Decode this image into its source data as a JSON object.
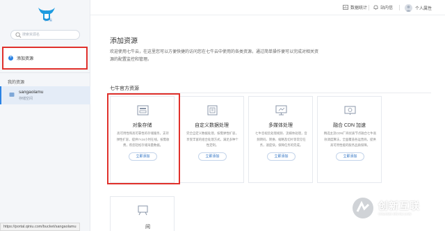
{
  "sidebar": {
    "logo_text": "七牛云",
    "search_placeholder": "搜索资源名",
    "add_resource": "添加资源",
    "my_resources": "我的资源",
    "resource": {
      "name": "sangaolamu",
      "type": "存储空间"
    }
  },
  "topbar": {
    "stats": "数据统计",
    "messages": "站内信",
    "user": "个人属性"
  },
  "main": {
    "title": "添加资源",
    "description": "欢迎使用七牛云，在这里您可以方便快捷的访问您在七牛云中使用的各类资源，通过简单操作便可以完成对相关资源的配置监控和管理。",
    "section": "七牛官方资源",
    "cards": [
      {
        "title": "对象存储",
        "desc": "高可用性和高可靠性的存储服务，支持弹性扩容，提供7×24小时在线，按需收费，帮您轻松存储海量数据。",
        "button": "立即添加"
      },
      {
        "title": "自定义数据处理",
        "desc": "完全自定义数据处理，按需弹性扩容，享受丰富的组合处理方式，满足多种个性定制。",
        "button": "立即添加"
      },
      {
        "title": "多媒体处理",
        "desc": "七牛音视云处理视频、流媒体处理，音频转码、转换、缩略及切片等常见任务，速度快，保障任务的完成。",
        "button": "立即添加"
      },
      {
        "title": "融合 CDN 加速",
        "desc": "精选主流CDN厂商优质节点融合七牛高效调度算法，全面覆盖各运营商，提供高可用性能的服务品质保障。",
        "button": "立即添加"
      }
    ],
    "card5_tail": "间"
  },
  "status_url": "https://portal.qiniu.com/bucket/sangaolamu",
  "watermark": {
    "cn": "创新互联",
    "en": "CHUANG XIN HU LIAN"
  },
  "colors": {
    "accent": "#2a82e4",
    "highlight": "#e0302b"
  }
}
